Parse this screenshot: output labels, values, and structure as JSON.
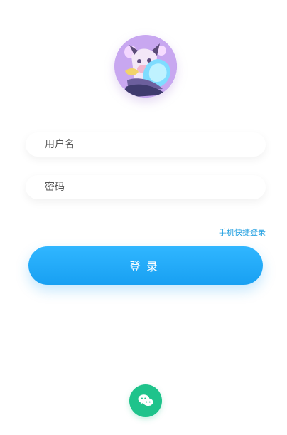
{
  "login": {
    "username_placeholder": "用户名",
    "password_placeholder": "密码",
    "quick_login_label": "手机快捷登录",
    "submit_label": "登录"
  },
  "social": {
    "wechat_icon": "wechat-icon"
  },
  "colors": {
    "accent": "#18a0f2",
    "link": "#1e9ee0",
    "wechat": "#1fc38b"
  }
}
